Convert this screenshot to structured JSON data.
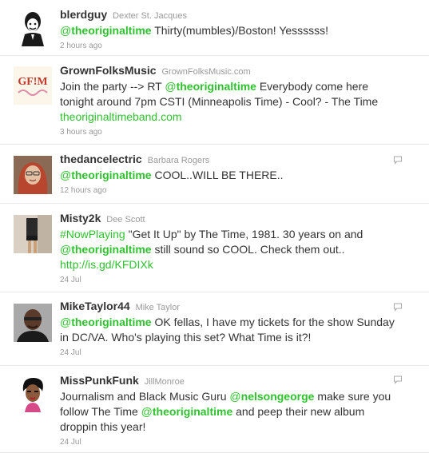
{
  "tweets": [
    {
      "screen_name": "blerdguy",
      "full_name": "Dexter St. Jacques",
      "mention": "theoriginaltime",
      "text_after": " Thirty(mumbles)/Boston! Yessssss!",
      "time": "2 hours ago"
    },
    {
      "screen_name": "GrownFolksMusic",
      "full_name": "GrownFolksMusic.com",
      "text_before": "Join the party --> RT ",
      "mention": "theoriginaltime",
      "text_after": " Everybody come here tonight around 7pm CSTI (Minneapolis Time) - Cool? - The Time",
      "link": "theoriginaltimeband.com",
      "time": "3 hours ago",
      "avatar_text": "GF!M"
    },
    {
      "screen_name": "thedancelectric",
      "full_name": "Barbara Rogers",
      "mention": "theoriginaltime",
      "text_after": " COOL..WILL BE THERE..",
      "time": "12 hours ago"
    },
    {
      "screen_name": "Misty2k",
      "full_name": "Dee Scott",
      "hashtag": "#NowPlaying",
      "text_before": " \"Get It Up\" by The Time, 1981. 30 years on and ",
      "mention": "theoriginaltime",
      "text_after": " still sound so COOL. Check them out..",
      "link": "http://is.gd/KFDIXk",
      "time": "24 Jul"
    },
    {
      "screen_name": "MikeTaylor44",
      "full_name": "Mike Taylor",
      "mention": "theoriginaltime",
      "text_after": " OK fellas, I have my tickets for the show Sunday in DC/VA. Who's playing this set? What Time is it?!",
      "time": "24 Jul"
    },
    {
      "screen_name": "MissPunkFunk",
      "full_name": "JillMonroe",
      "text_before": "Journalism and Black Music Guru ",
      "mention_1": "nelsongeorge",
      "text_mid": " make sure you follow The Time ",
      "mention": "theoriginaltime",
      "text_after": " and peep their new album droppin this year!",
      "time": "24 Jul"
    }
  ],
  "at_sign": "@",
  "colors": {
    "link": "#2fc22f",
    "meta": "#999999",
    "text": "#333333",
    "divider": "#e8e8e8"
  }
}
